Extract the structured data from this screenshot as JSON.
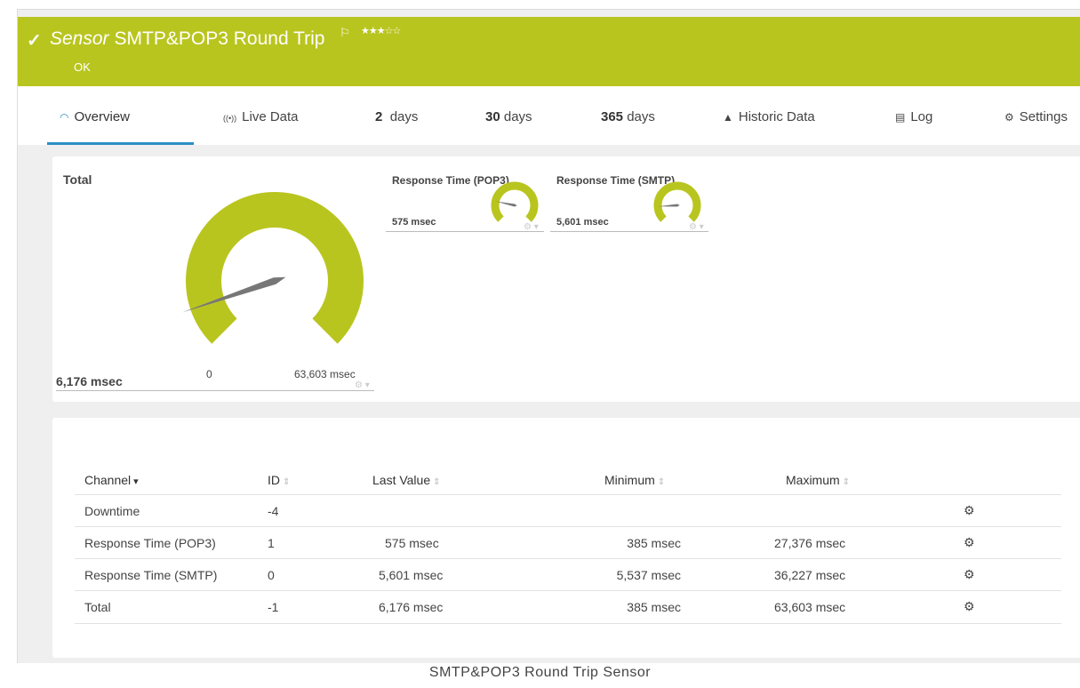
{
  "header": {
    "check_icon": "✓",
    "kind": "Sensor",
    "title": "SMTP&POP3 Round Trip",
    "flag_icon": "⚐",
    "stars": "★★★☆☆",
    "status": "OK",
    "color": "#b9c51f"
  },
  "tabs": [
    {
      "icon": "◠",
      "label": "Overview"
    },
    {
      "icon": "((•))",
      "label": "Live Data"
    },
    {
      "num": "2",
      "label": "days"
    },
    {
      "num": "30",
      "label": "days"
    },
    {
      "num": "365",
      "label": "days"
    },
    {
      "icon": "▲",
      "label": "Historic Data"
    },
    {
      "icon": "▤",
      "label": "Log"
    },
    {
      "icon": "⚙",
      "label": "Settings"
    }
  ],
  "gauges": {
    "total": {
      "title": "Total",
      "value": "6,176 msec",
      "min_label": "0",
      "max_label": "63,603 msec",
      "fraction": 0.097
    },
    "pop3": {
      "title": "Response Time (POP3)",
      "value": "575 msec",
      "fraction": 0.21
    },
    "smtp": {
      "title": "Response Time (SMTP)",
      "value": "5,601 msec",
      "fraction": 0.155
    },
    "tools_icon": "⚙ ▾"
  },
  "table": {
    "headers": {
      "channel": "Channel",
      "id": "ID",
      "last": "Last Value",
      "min": "Minimum",
      "max": "Maximum"
    },
    "sort_active": "▾",
    "sort_idle": "⇕",
    "rows": [
      {
        "channel": "Downtime",
        "id": "-4",
        "last": "",
        "min": "",
        "max": ""
      },
      {
        "channel": "Response Time (POP3)",
        "id": "1",
        "last": "575 msec",
        "min": "385 msec",
        "max": "27,376 msec"
      },
      {
        "channel": "Response Time (SMTP)",
        "id": "0",
        "last": "5,601 msec",
        "min": "5,537 msec",
        "max": "36,227 msec"
      },
      {
        "channel": "Total",
        "id": "-1",
        "last": "6,176 msec",
        "min": "385 msec",
        "max": "63,603 msec"
      }
    ],
    "row_icon": "⚙"
  },
  "caption": "SMTP&POP3 Round Trip Sensor"
}
